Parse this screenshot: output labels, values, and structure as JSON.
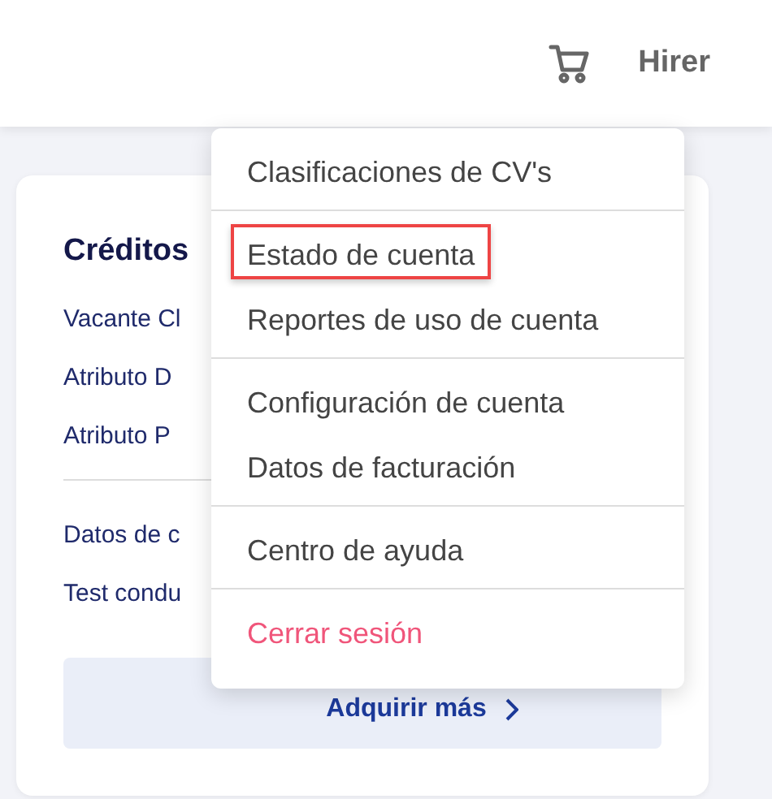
{
  "header": {
    "user": "Hirer"
  },
  "card": {
    "title": "Créditos",
    "items": [
      {
        "label": "Vacante Cl"
      },
      {
        "label": "Atributo D"
      },
      {
        "label": "Atributo P"
      }
    ],
    "links": [
      {
        "label": "Datos de c"
      },
      {
        "label": "Test condu"
      }
    ],
    "button": "Adquirir más"
  },
  "menu": {
    "groups": [
      [
        {
          "label": "Clasificaciones de CV's",
          "outlined": false,
          "kind": "normal"
        }
      ],
      [
        {
          "label": "Estado de cuenta",
          "outlined": true,
          "kind": "normal"
        },
        {
          "label": "Reportes de uso de cuenta",
          "outlined": false,
          "kind": "normal"
        }
      ],
      [
        {
          "label": "Configuración de cuenta",
          "outlined": false,
          "kind": "normal"
        },
        {
          "label": "Datos de facturación",
          "outlined": false,
          "kind": "normal"
        }
      ],
      [
        {
          "label": "Centro de ayuda",
          "outlined": false,
          "kind": "normal"
        }
      ],
      [
        {
          "label": "Cerrar sesión",
          "outlined": false,
          "kind": "danger"
        }
      ]
    ]
  }
}
